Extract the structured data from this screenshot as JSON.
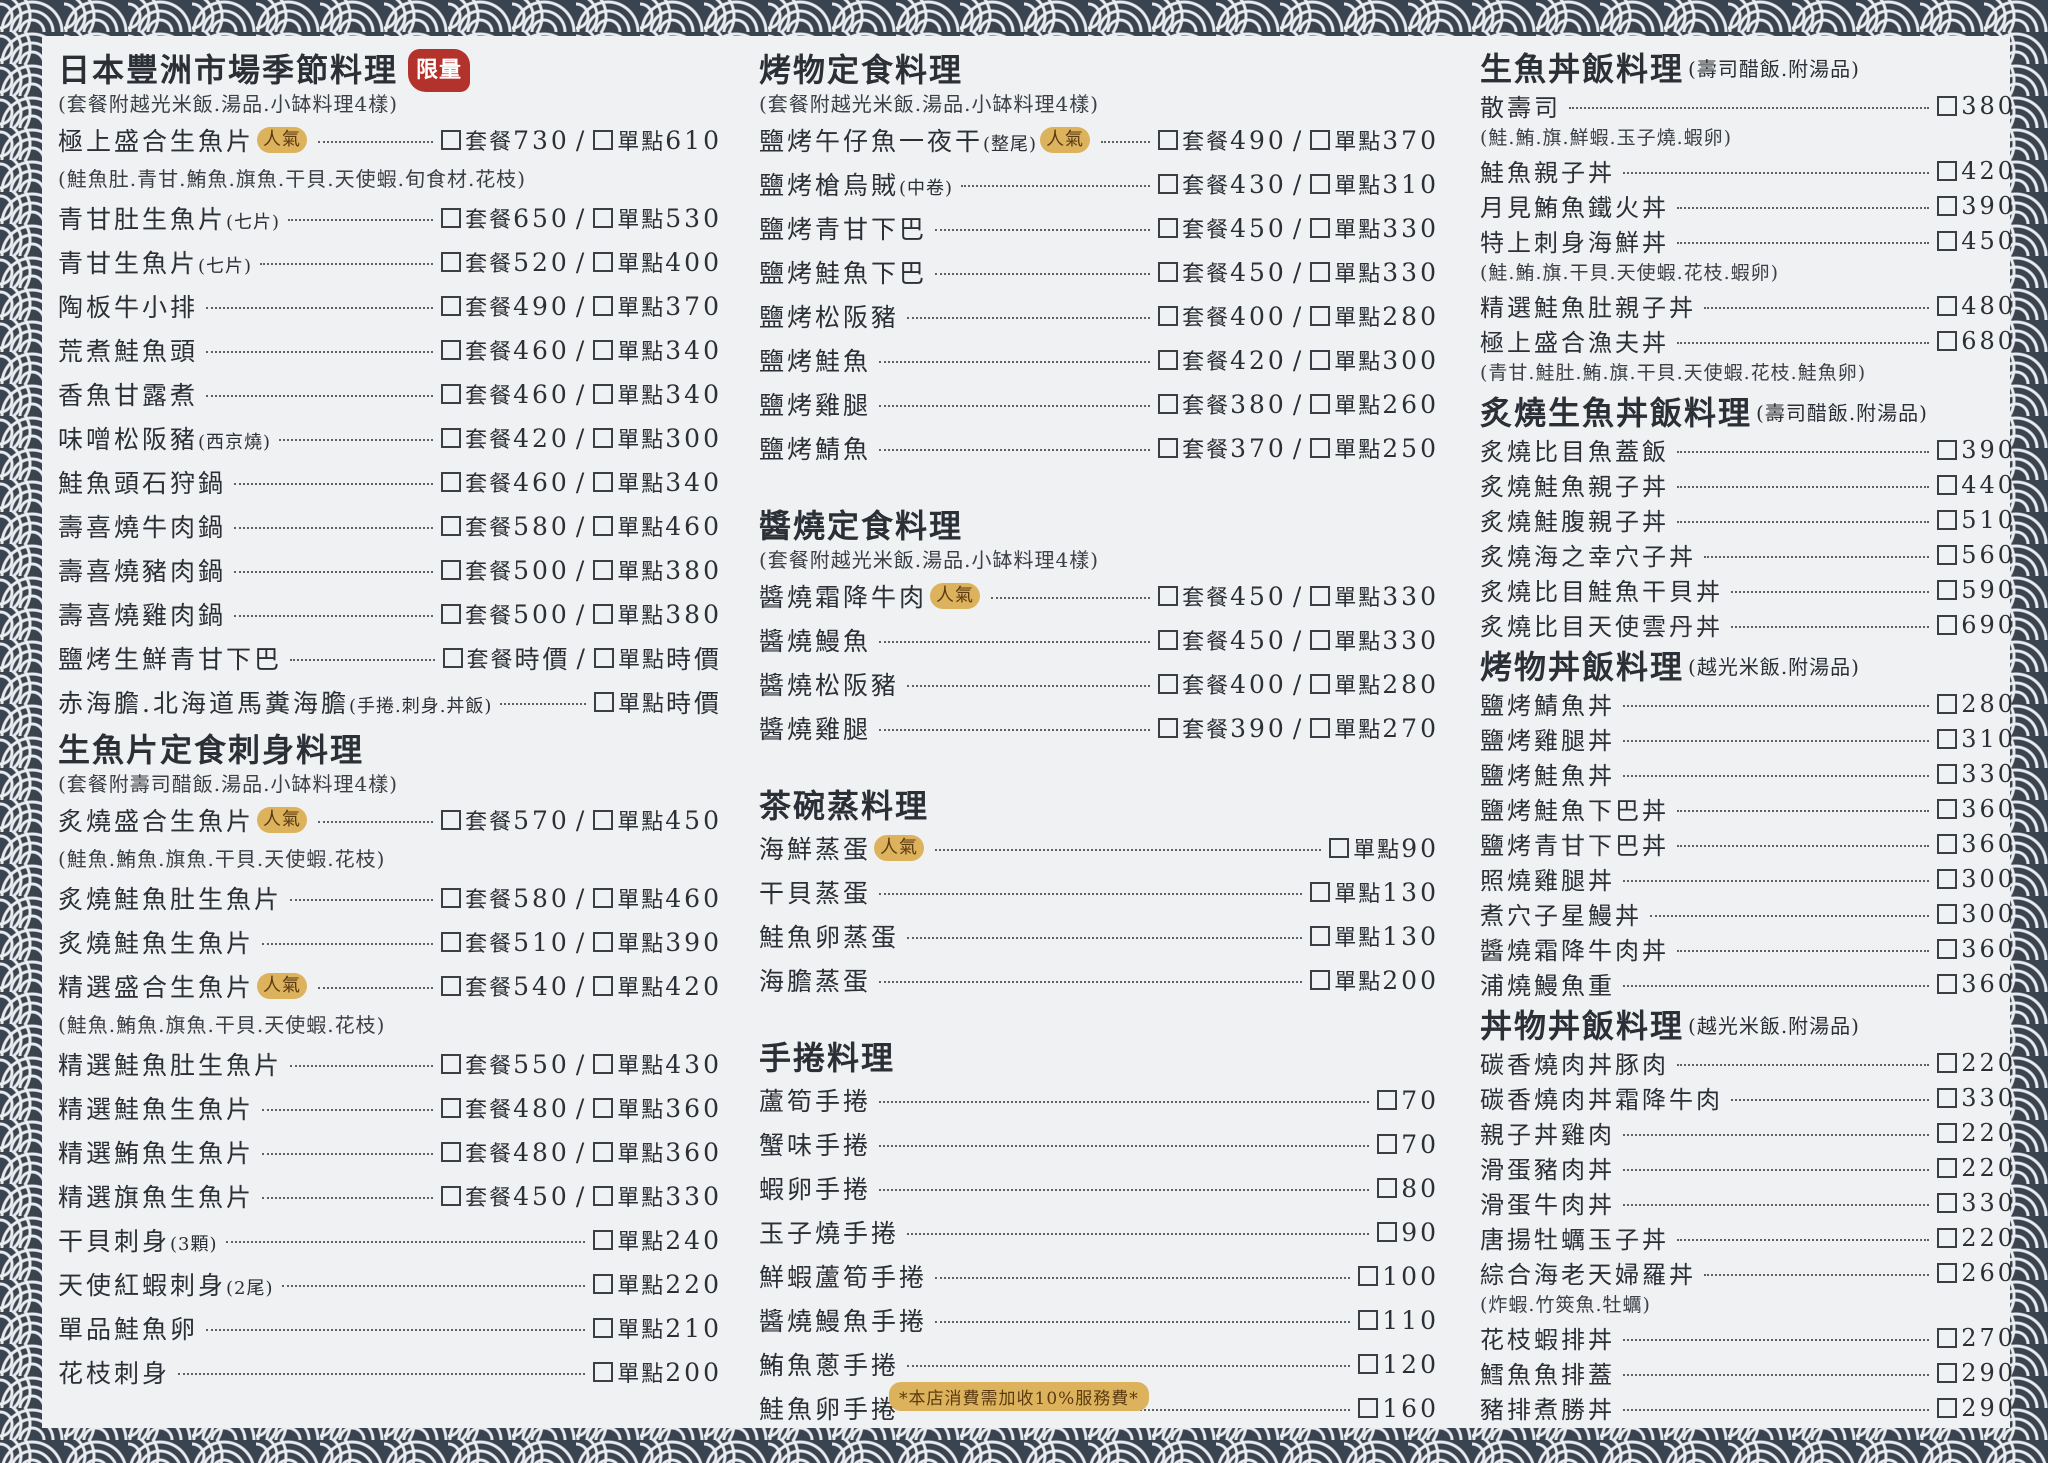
{
  "sections": {
    "seasonal": {
      "title": "日本豐洲市場季節料理",
      "badge": "限量",
      "note": "(套餐附越光米飯.湯品.小缽料理4樣)",
      "items": [
        {
          "name": "極上盛合生魚片",
          "pop": "人氣",
          "set": "730",
          "single": "610"
        },
        {
          "note": "(鮭魚肚.青甘.鮪魚.旗魚.干貝.天使蝦.旬食材.花枝)"
        },
        {
          "name": "青甘肚生魚片",
          "small": "(七片)",
          "set": "650",
          "single": "530"
        },
        {
          "name": "青甘生魚片",
          "small": "(七片)",
          "set": "520",
          "single": "400"
        },
        {
          "name": "陶板牛小排",
          "set": "490",
          "single": "370"
        },
        {
          "name": "荒煮鮭魚頭",
          "set": "460",
          "single": "340"
        },
        {
          "name": "香魚甘露煮",
          "set": "460",
          "single": "340"
        },
        {
          "name": "味噌松阪豬",
          "small": "(西京燒)",
          "set": "420",
          "single": "300"
        },
        {
          "name": "鮭魚頭石狩鍋",
          "set": "460",
          "single": "340"
        },
        {
          "name": "壽喜燒牛肉鍋",
          "set": "580",
          "single": "460"
        },
        {
          "name": "壽喜燒豬肉鍋",
          "set": "500",
          "single": "380"
        },
        {
          "name": "壽喜燒雞肉鍋",
          "set": "500",
          "single": "380"
        },
        {
          "name": "鹽烤生鮮青甘下巴",
          "set": "時價",
          "single": "時價"
        },
        {
          "name": "赤海膽.北海道馬糞海膽",
          "small": "(手捲.刺身.丼飯)",
          "single": "時價"
        }
      ]
    },
    "sashimi": {
      "title": "生魚片定食刺身料理",
      "note": "(套餐附壽司醋飯.湯品.小缽料理4樣)",
      "items": [
        {
          "name": "炙燒盛合生魚片",
          "pop": "人氣",
          "set": "570",
          "single": "450"
        },
        {
          "note": "(鮭魚.鮪魚.旗魚.干貝.天使蝦.花枝)"
        },
        {
          "name": "炙燒鮭魚肚生魚片",
          "set": "580",
          "single": "460"
        },
        {
          "name": "炙燒鮭魚生魚片",
          "set": "510",
          "single": "390"
        },
        {
          "name": "精選盛合生魚片",
          "pop": "人氣",
          "set": "540",
          "single": "420"
        },
        {
          "note": "(鮭魚.鮪魚.旗魚.干貝.天使蝦.花枝)"
        },
        {
          "name": "精選鮭魚肚生魚片",
          "set": "550",
          "single": "430"
        },
        {
          "name": "精選鮭魚生魚片",
          "set": "480",
          "single": "360"
        },
        {
          "name": "精選鮪魚生魚片",
          "set": "480",
          "single": "360"
        },
        {
          "name": "精選旗魚生魚片",
          "set": "450",
          "single": "330"
        },
        {
          "name": "干貝刺身",
          "small": "(3顆)",
          "single": "240"
        },
        {
          "name": "天使紅蝦刺身",
          "small": "(2尾)",
          "single": "220"
        },
        {
          "name": "單品鮭魚卵",
          "single": "210"
        },
        {
          "name": "花枝刺身",
          "single": "200"
        }
      ]
    },
    "grill": {
      "title": "烤物定食料理",
      "note": "(套餐附越光米飯.湯品.小缽料理4樣)",
      "items": [
        {
          "name": "鹽烤午仔魚一夜干",
          "small": "(整尾)",
          "pop": "人氣",
          "set": "490",
          "single": "370"
        },
        {
          "name": "鹽烤槍烏賊",
          "small": "(中卷)",
          "set": "430",
          "single": "310"
        },
        {
          "name": "鹽烤青甘下巴",
          "set": "450",
          "single": "330"
        },
        {
          "name": "鹽烤鮭魚下巴",
          "set": "450",
          "single": "330"
        },
        {
          "name": "鹽烤松阪豬",
          "set": "400",
          "single": "280"
        },
        {
          "name": "鹽烤鮭魚",
          "set": "420",
          "single": "300"
        },
        {
          "name": "鹽烤雞腿",
          "set": "380",
          "single": "260"
        },
        {
          "name": "鹽烤鯖魚",
          "set": "370",
          "single": "250"
        }
      ]
    },
    "sauce": {
      "title": "醬燒定食料理",
      "note": "(套餐附越光米飯.湯品.小缽料理4樣)",
      "items": [
        {
          "name": "醬燒霜降牛肉",
          "pop": "人氣",
          "set": "450",
          "single": "330"
        },
        {
          "name": "醬燒鰻魚",
          "set": "450",
          "single": "330"
        },
        {
          "name": "醬燒松阪豬",
          "set": "400",
          "single": "280"
        },
        {
          "name": "醬燒雞腿",
          "set": "390",
          "single": "270"
        }
      ]
    },
    "chawan": {
      "title": "茶碗蒸料理",
      "items": [
        {
          "name": "海鮮蒸蛋",
          "pop": "人氣",
          "single": " 90"
        },
        {
          "name": "干貝蒸蛋",
          "single": "130"
        },
        {
          "name": "鮭魚卵蒸蛋",
          "single": "130"
        },
        {
          "name": "海膽蒸蛋",
          "single": "200"
        }
      ]
    },
    "handroll": {
      "title": "手捲料理",
      "items": [
        {
          "name": "蘆筍手捲",
          "price": " 70"
        },
        {
          "name": "蟹味手捲",
          "price": " 70"
        },
        {
          "name": "蝦卵手捲",
          "price": " 80"
        },
        {
          "name": "玉子燒手捲",
          "price": " 90"
        },
        {
          "name": "鮮蝦蘆筍手捲",
          "price": "100"
        },
        {
          "name": "醬燒鰻魚手捲",
          "price": "110"
        },
        {
          "name": "鮪魚蔥手捲",
          "price": "120"
        },
        {
          "name": "鮭魚卵手捲",
          "price": "160"
        }
      ]
    },
    "rawbowl": {
      "title": "生魚丼飯料理",
      "sub": "(壽司醋飯.附湯品)",
      "items": [
        {
          "name": "散壽司",
          "price": "380"
        },
        {
          "note": "(鮭.鮪.旗.鮮蝦.玉子燒.蝦卵)"
        },
        {
          "name": "鮭魚親子丼",
          "price": "420"
        },
        {
          "name": "月見鮪魚鐵火丼",
          "price": "390"
        },
        {
          "name": "特上刺身海鮮丼",
          "price": "450"
        },
        {
          "note": "(鮭.鮪.旗.干貝.天使蝦.花枝.蝦卵)"
        },
        {
          "name": "精選鮭魚肚親子丼",
          "price": "480"
        },
        {
          "name": "極上盛合漁夫丼",
          "price": "680"
        },
        {
          "note": "(青甘.鮭肚.鮪.旗.干貝.天使蝦.花枝.鮭魚卵)"
        }
      ]
    },
    "searedbowl": {
      "title": "炙燒生魚丼飯料理",
      "sub": "(壽司醋飯.附湯品)",
      "items": [
        {
          "name": "炙燒比目魚蓋飯",
          "price": "390"
        },
        {
          "name": "炙燒鮭魚親子丼",
          "price": "440"
        },
        {
          "name": "炙燒鮭腹親子丼",
          "price": "510"
        },
        {
          "name": "炙燒海之幸穴子丼",
          "price": "560"
        },
        {
          "name": "炙燒比目鮭魚干貝丼",
          "price": "590"
        },
        {
          "name": "炙燒比目天使雲丹丼",
          "price": "690"
        }
      ]
    },
    "grillbowl": {
      "title": "烤物丼飯料理",
      "sub": "(越光米飯.附湯品)",
      "items": [
        {
          "name": "鹽烤鯖魚丼",
          "price": "280"
        },
        {
          "name": "鹽烤雞腿丼",
          "price": "310"
        },
        {
          "name": "鹽烤鮭魚丼",
          "price": "330"
        },
        {
          "name": "鹽烤鮭魚下巴丼",
          "price": "360"
        },
        {
          "name": "鹽烤青甘下巴丼",
          "price": "360"
        },
        {
          "name": "照燒雞腿丼",
          "price": "300"
        },
        {
          "name": "煮穴子星鰻丼",
          "price": "300"
        },
        {
          "name": "醬燒霜降牛肉丼",
          "price": "360"
        },
        {
          "name": "浦燒鰻魚重",
          "price": "360"
        }
      ]
    },
    "donbowl": {
      "title": "丼物丼飯料理",
      "sub": "(越光米飯.附湯品)",
      "items": [
        {
          "name": "碳香燒肉丼豚肉",
          "price": "220"
        },
        {
          "name": "碳香燒肉丼霜降牛肉",
          "price": "330"
        },
        {
          "name": "親子丼雞肉",
          "price": "220"
        },
        {
          "name": "滑蛋豬肉丼",
          "price": "220"
        },
        {
          "name": "滑蛋牛肉丼",
          "price": "330"
        },
        {
          "name": "唐揚牡蠣玉子丼",
          "price": "220"
        },
        {
          "name": "綜合海老天婦羅丼",
          "price": "260"
        },
        {
          "note": "(炸蝦.竹筴魚.牡蠣)"
        },
        {
          "name": "花枝蝦排丼",
          "price": "270"
        },
        {
          "name": "鱈魚魚排蓋",
          "price": "290"
        },
        {
          "name": "豬排煮勝丼",
          "price": "290"
        }
      ]
    }
  },
  "labels": {
    "set": "套餐",
    "single": "單點",
    "slash": "/"
  },
  "footer": {
    "service_fee": "*本店消費需加收10%服務費*"
  },
  "colors": {
    "wave_dark": "#3a4350",
    "paper": "#f0f1f3",
    "badge_red": "#b4322c",
    "badge_gold": "#ddb25d"
  }
}
